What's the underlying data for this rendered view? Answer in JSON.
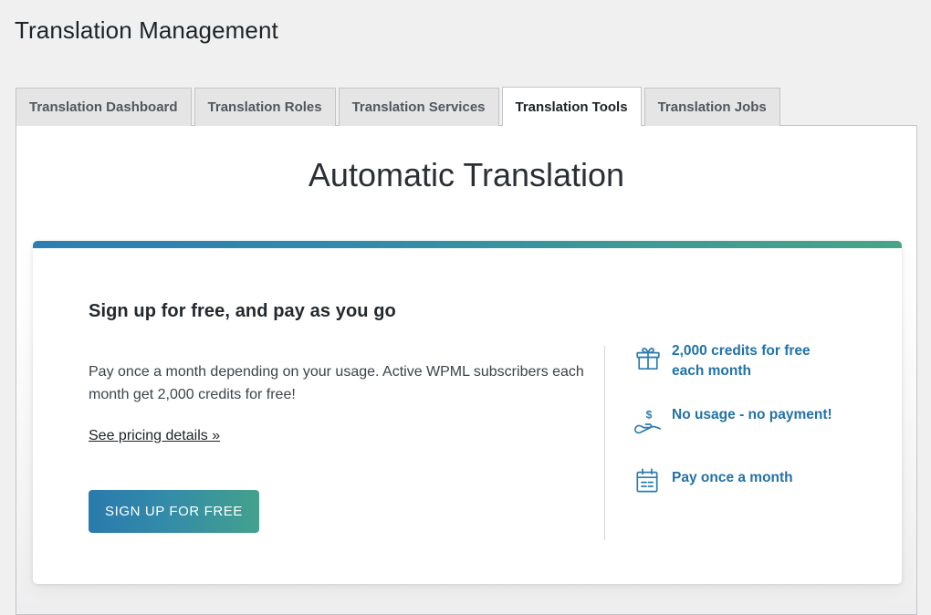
{
  "page": {
    "title": "Translation Management"
  },
  "tabs": [
    {
      "label": "Translation Dashboard",
      "active": false
    },
    {
      "label": "Translation Roles",
      "active": false
    },
    {
      "label": "Translation Services",
      "active": false
    },
    {
      "label": "Translation Tools",
      "active": true
    },
    {
      "label": "Translation Jobs",
      "active": false
    }
  ],
  "main": {
    "section_title": "Automatic Translation",
    "card": {
      "heading": "Sign up for free, and pay as you go",
      "paragraph": "Pay once a month depending on your usage. Active WPML subscribers each month get 2,000 credits for free!",
      "pricing_link": "See pricing details »",
      "signup_button": "SIGN UP FOR FREE",
      "features": [
        {
          "icon": "gift-icon",
          "text": "2,000 credits for free each month"
        },
        {
          "icon": "hand-dollar-icon",
          "text": "No usage - no payment!"
        },
        {
          "icon": "calendar-icon",
          "text": "Pay once a month"
        }
      ]
    }
  },
  "colors": {
    "gradient_start": "#2d7eb0",
    "gradient_end": "#48a487",
    "feature_text": "#2272a8",
    "page_background": "#f0f0f1",
    "panel_background": "#ffffff"
  }
}
